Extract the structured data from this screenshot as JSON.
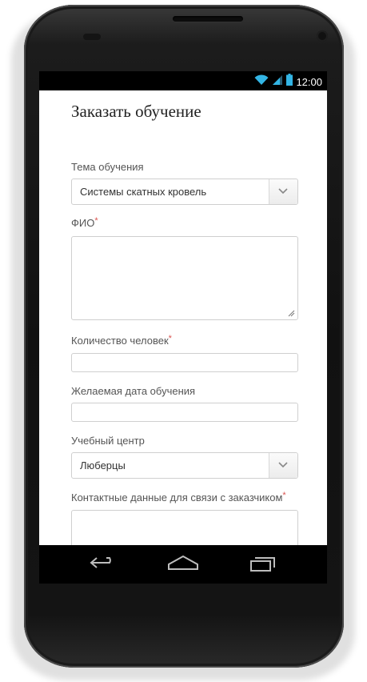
{
  "status_bar": {
    "time": "12:00",
    "icons": [
      "wifi-icon",
      "signal-icon",
      "battery-icon"
    ],
    "icon_color": "#33b5e5"
  },
  "form": {
    "title": "Заказать обучение",
    "required_mark": "*",
    "fields": {
      "topic": {
        "label": "Тема обучения",
        "value": "Системы скатных кровель"
      },
      "fio": {
        "label": "ФИО",
        "value": ""
      },
      "people_count": {
        "label": "Количество человек",
        "value": ""
      },
      "desired_date": {
        "label": "Желаемая дата обучения",
        "value": ""
      },
      "center": {
        "label": "Учебный центр",
        "value": "Люберцы"
      },
      "contacts": {
        "label": "Контактные данные для связи с заказчиком",
        "value": ""
      }
    },
    "accent_required_color": "#d9534f"
  },
  "nav_bar": {
    "buttons": [
      "back-icon",
      "home-icon",
      "recent-apps-icon"
    ]
  }
}
